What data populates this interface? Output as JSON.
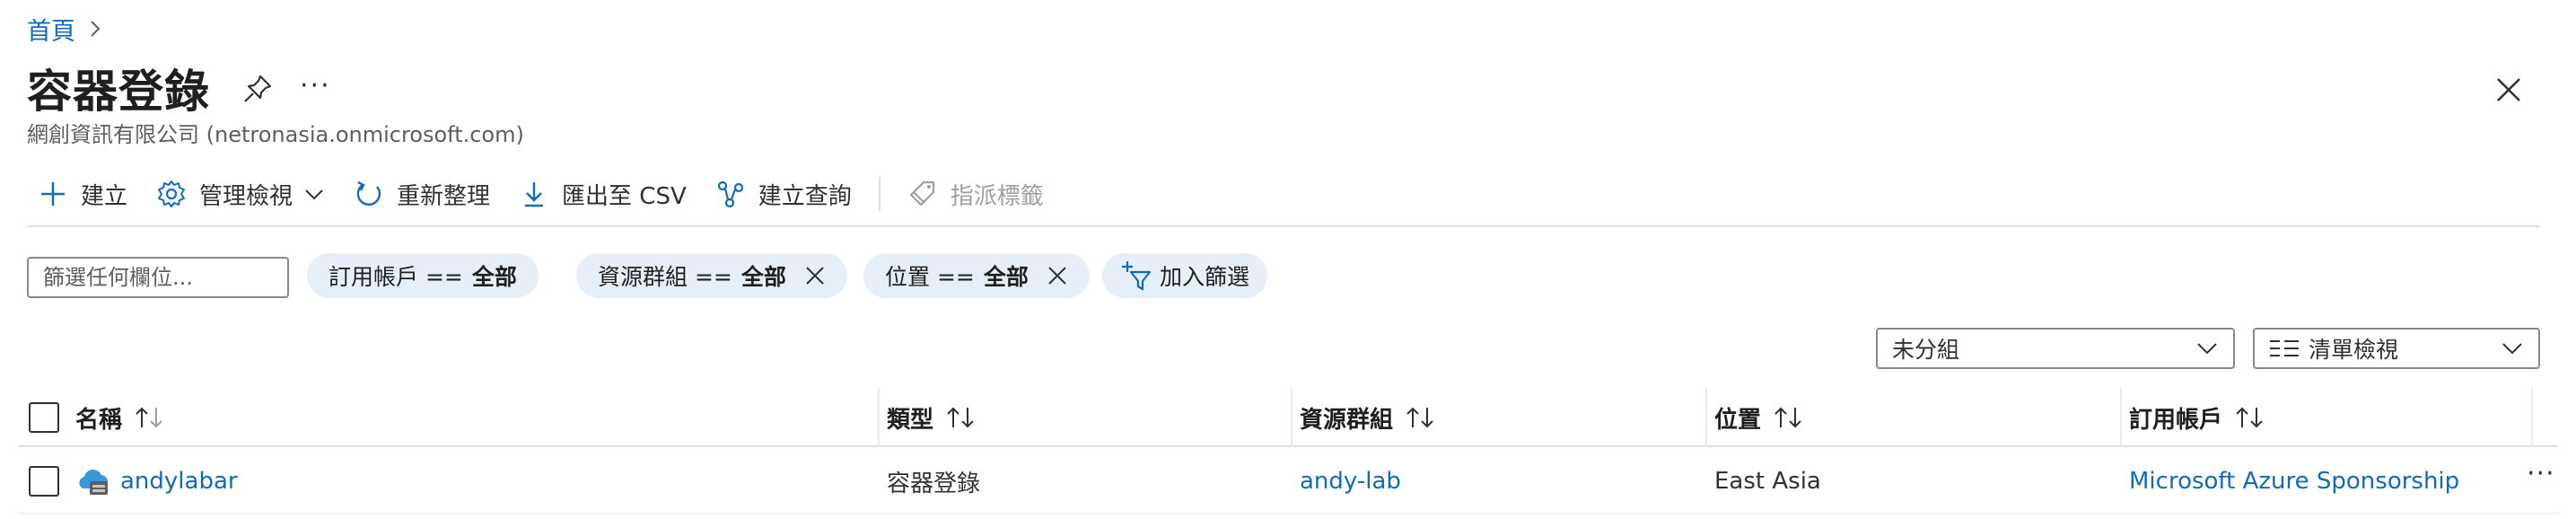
{
  "breadcrumb": {
    "home": "首頁"
  },
  "header": {
    "title": "容器登錄",
    "subtitle": "網創資訊有限公司 (netronasia.onmicrosoft.com)",
    "more": "···"
  },
  "toolbar": {
    "create": "建立",
    "manage_view": "管理檢視",
    "refresh": "重新整理",
    "export_csv": "匯出至 CSV",
    "open_query": "建立查詢",
    "assign_tags": "指派標籤"
  },
  "filters": {
    "search_placeholder": "篩選任何欄位...",
    "subscription": {
      "label": "訂用帳戶 ==",
      "value": "全部"
    },
    "resource_group": {
      "label": "資源群組 ==",
      "value": "全部"
    },
    "location": {
      "label": "位置 ==",
      "value": "全部"
    },
    "add_filter": "加入篩選"
  },
  "grouping": {
    "selected": "未分組"
  },
  "view": {
    "selected": "清單檢視",
    "icon": "list-icon"
  },
  "table": {
    "columns": [
      "名稱",
      "類型",
      "資源群組",
      "位置",
      "訂用帳戶"
    ],
    "rows": [
      {
        "name": "andylabar",
        "type": "容器登錄",
        "resource_group": "andy-lab",
        "location": "East Asia",
        "subscription": "Microsoft Azure Sponsorship",
        "more": "···"
      }
    ]
  },
  "colors": {
    "accent": "#0f6cbd",
    "pill_bg": "#e6eff8",
    "border": "#e1dfdd"
  }
}
